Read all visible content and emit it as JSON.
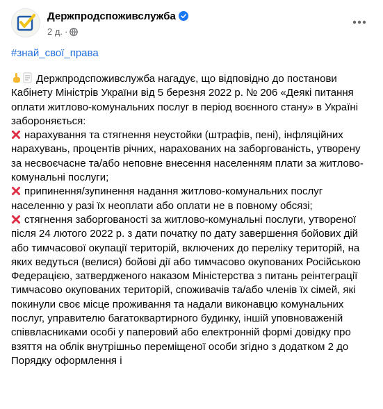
{
  "post": {
    "author": "Держпродспоживслужба",
    "time": "2 д.",
    "separator": "·",
    "hashtag": "#знай_свої_права",
    "intro": " Держпродспоживслужба нагадує, що відповідно до постанови Кабінету Міністрів України від 5 березня 2022 р. № 206 «Деякі питання оплати житлово-комунальних послуг в період воєнного стану» в Україні забороняється:",
    "items": [
      "нарахування та стягнення неустойки (штрафів, пені), інфляційних нарахувань, процентів річних, нарахованих на заборгованість, утворену за несвоєчасне та/або неповне внесення населенням плати за житлово-комунальні послуги;",
      "припинення/зупинення надання житлово-комунальних послуг населенню у разі їх неоплати або оплати не в повному обсязі;",
      "стягнення заборгованості за житлово-комунальні послуги, утвореної після 24 лютого 2022 р. з дати початку по дату завершення бойових дій або тимчасової окупації територій, включених до переліку територій, на яких ведуться (велися) бойові дії або тимчасово окупованих Російською Федерацією, затвердженого наказом Міністерства з питань реінтеграції тимчасово окупованих територій, споживачів та/або членів їх сімей, які покинули своє місце проживання та надали виконавцю комунальних послуг, управителю багатоквартирного будинку, іншій уповноваженій співвласниками особі у паперовий або електронній формі довідку про взяття на облік внутрішньо переміщеної особи згідно з додатком 2 до Порядку оформлення і"
    ]
  },
  "icons": {
    "intro_emoji_1": "pointing-hand-icon",
    "intro_emoji_2": "memo-icon",
    "item_marker": "red-cross-icon",
    "verified": "verified-badge-icon",
    "privacy": "globe-icon",
    "more": "more-horizontal-icon"
  },
  "colors": {
    "link": "#216fdb",
    "verified": "#1877f2",
    "cross": "#dd2e44",
    "meta": "#65676b"
  }
}
